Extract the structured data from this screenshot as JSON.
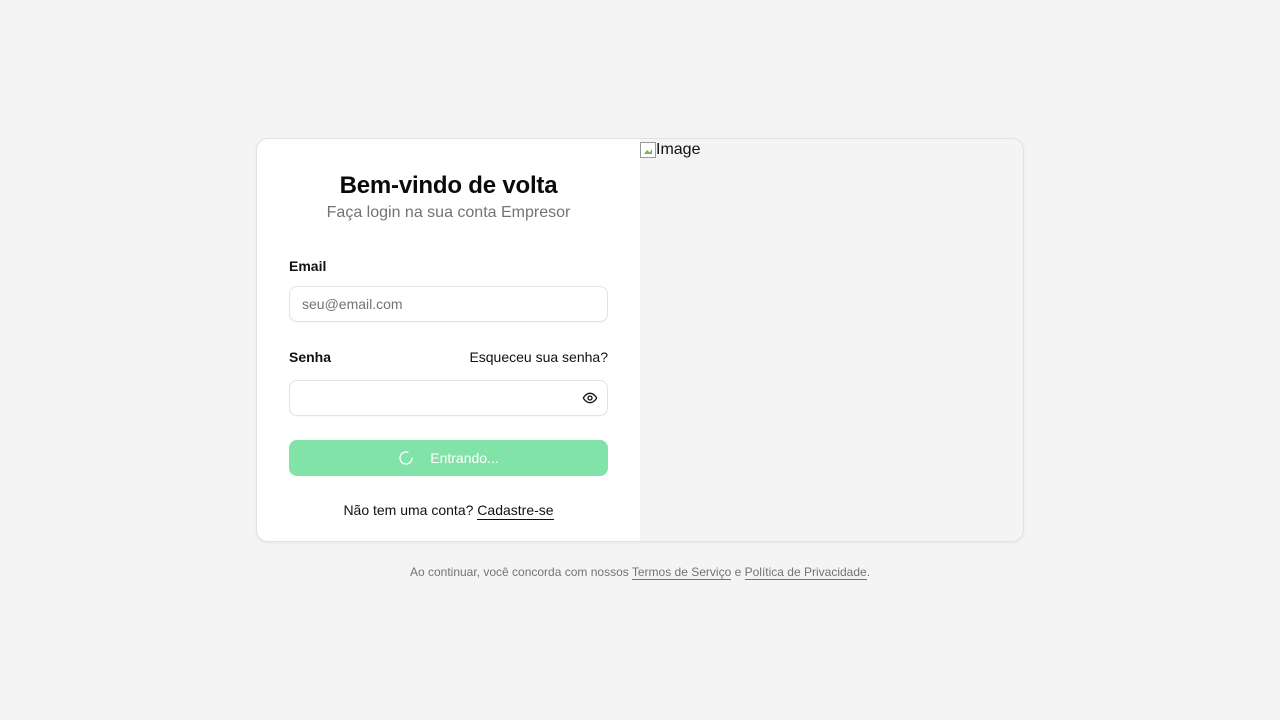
{
  "login": {
    "title": "Bem-vindo de volta",
    "subtitle": "Faça login na sua conta Empresor",
    "email_label": "Email",
    "email_placeholder": "seu@email.com",
    "email_value": "",
    "password_label": "Senha",
    "forgot_link": "Esqueceu sua senha?",
    "password_value": "",
    "submit_label": "Entrando...",
    "signup_prompt": "Não tem uma conta?",
    "signup_link": "Cadastre-se"
  },
  "image_panel": {
    "alt_text": "Image"
  },
  "footer": {
    "text_before": "Ao continuar, você concorda com nossos",
    "terms_link": "Termos de Serviço",
    "conjunction": "e",
    "privacy_link": "Política de Privacidade",
    "period": "."
  },
  "colors": {
    "background": "#f4f4f4",
    "button": "#82e3a8",
    "muted_text": "#737373"
  },
  "icons": {
    "password_toggle": "eye-icon",
    "loading": "spinner-icon"
  }
}
